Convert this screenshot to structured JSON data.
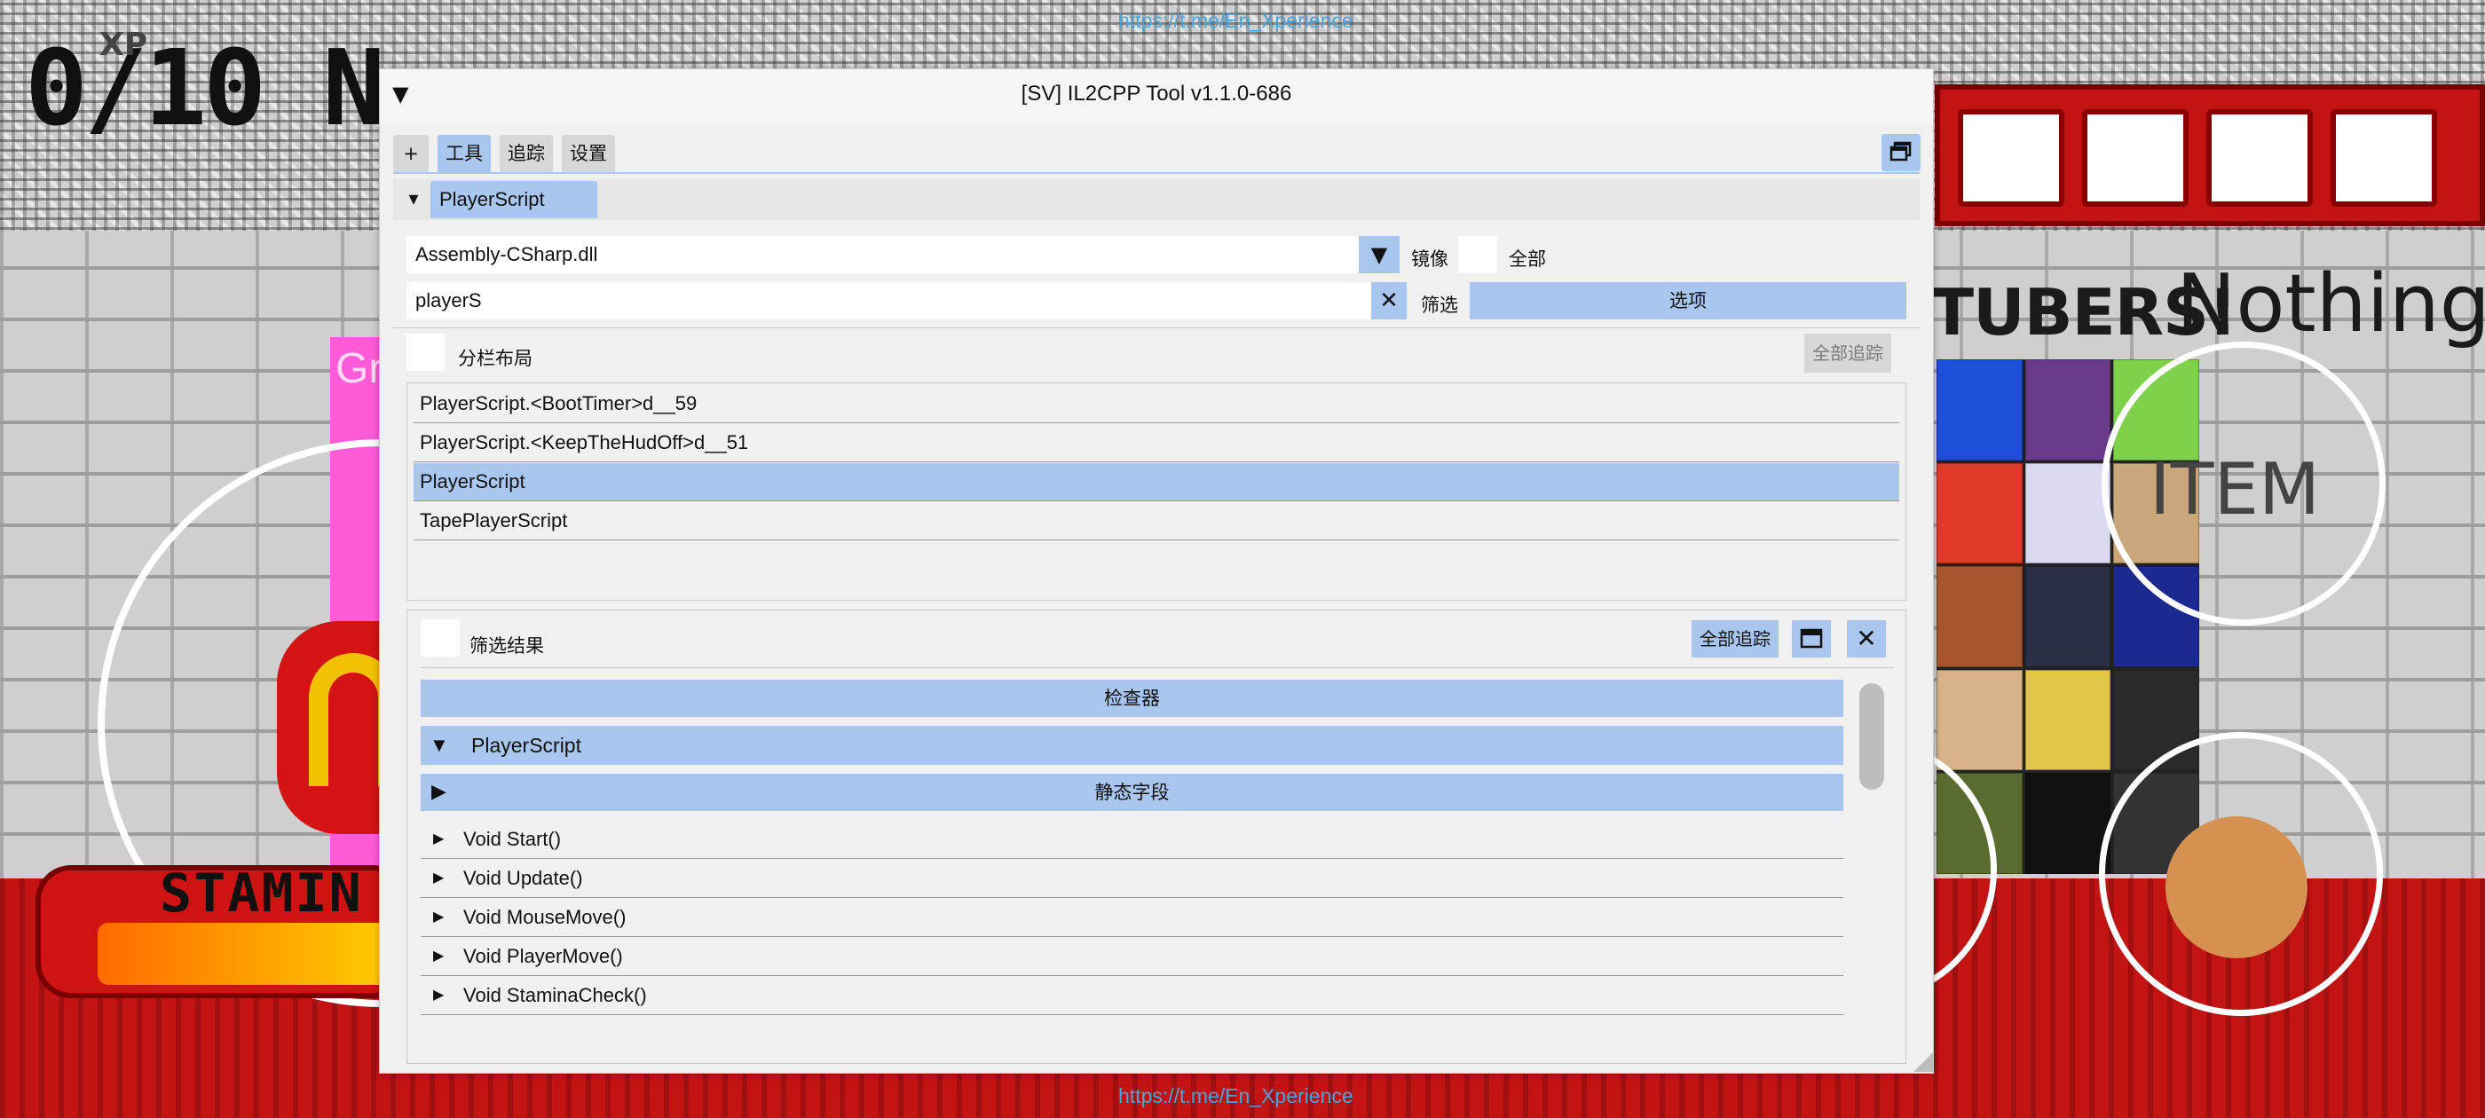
{
  "hud": {
    "score": "0/10 N",
    "xp": "XP",
    "stamina": "STAMIN",
    "gr": "Gr",
    "youtubers": "TUBERS!",
    "nothing": "Nothing",
    "item": "ITEM"
  },
  "watermark": {
    "top": "https://t.me/En_Xperience",
    "bottom": "https://t.me/En_Xperience"
  },
  "window": {
    "title": "[SV] IL2CPP Tool v1.1.0-686",
    "collapse_glyph": "▼",
    "tabs": {
      "add": "+",
      "tools": "工具",
      "trace": "追踪",
      "settings": "设置"
    },
    "active_tab": "tools"
  },
  "subheader": {
    "collapse_glyph": "▾",
    "tab": "PlayerScript"
  },
  "assembly": {
    "value": "Assembly-CSharp.dll",
    "arrow": "▼"
  },
  "labels": {
    "mirror": "镜像",
    "all": "全部",
    "filter": "筛选",
    "split_layout": "分栏布局",
    "filter_results": "筛选结果"
  },
  "filter": {
    "value": "playerS",
    "clear_glyph": "✕"
  },
  "buttons": {
    "options": "选项",
    "trace_all_disabled": "全部追踪",
    "trace_all": "全部追踪",
    "close": "✕",
    "inspector": "检查器"
  },
  "class_list": [
    "PlayerScript.<BootTimer>d__59",
    "PlayerScript.<KeepTheHudOff>d__51",
    "PlayerScript",
    "TapePlayerScript"
  ],
  "selected_class_index": 2,
  "inspector": {
    "node_title": "PlayerScript",
    "node_arrow": "▼",
    "static_fields": "静态字段",
    "static_arrow": "▶",
    "method_arrow": "▶",
    "methods": [
      "Void Start()",
      "Void Update()",
      "Void MouseMove()",
      "Void PlayerMove()",
      "Void StaminaCheck()"
    ]
  },
  "colors": {
    "accent": "#a9c7ee",
    "window_bg": "#f0f0f0",
    "link": "#4aa3d8"
  }
}
